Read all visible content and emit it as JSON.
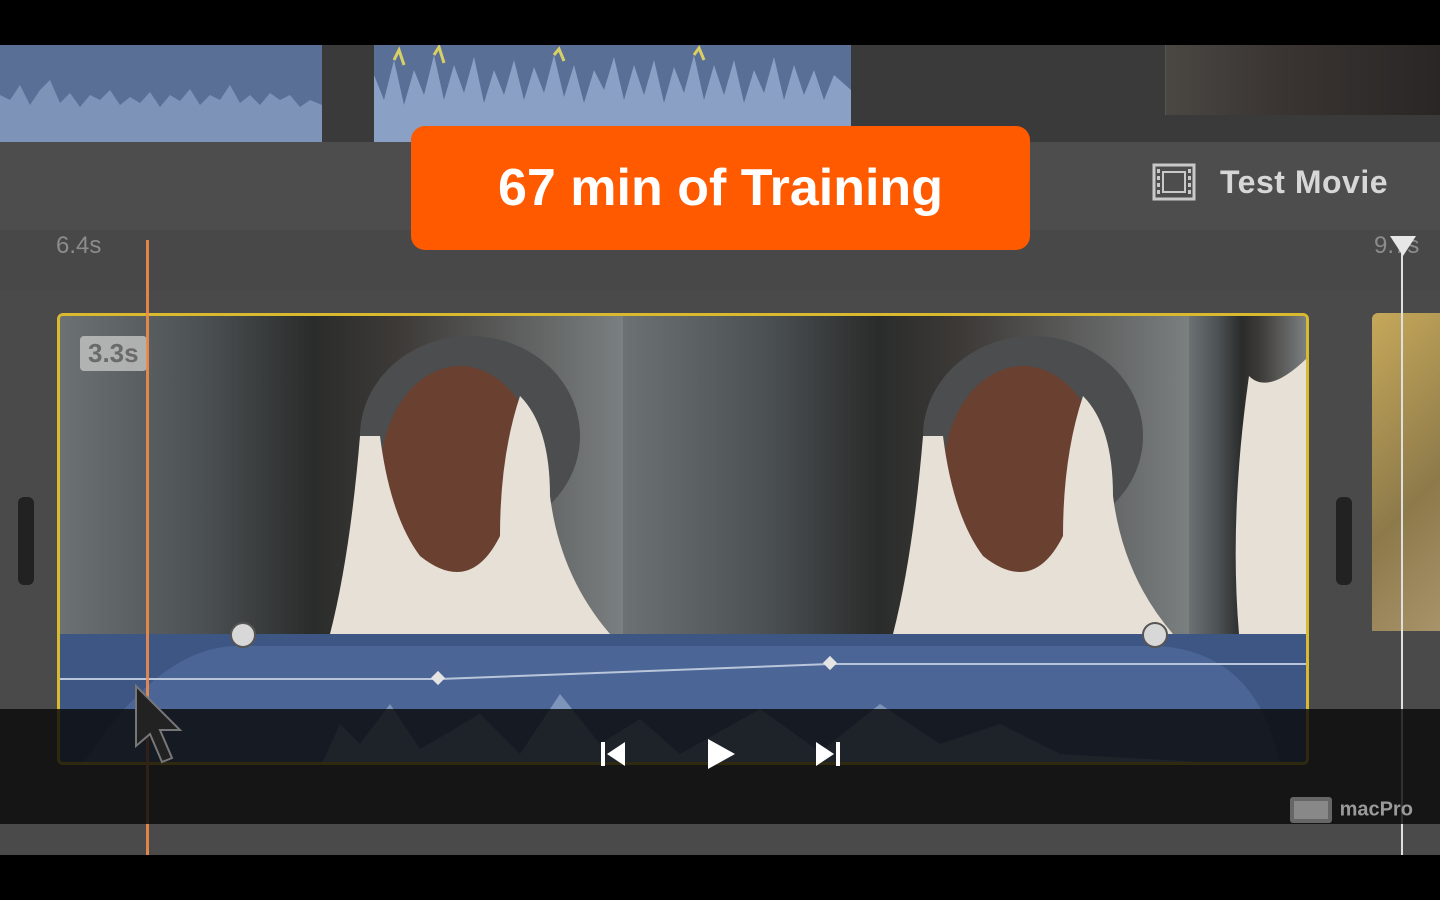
{
  "promo": {
    "text": "67 min of Training"
  },
  "ruler": {
    "start_time": "6.4s",
    "end_time": "9.7s"
  },
  "project": {
    "title": "Test Movie",
    "icon": "film-icon"
  },
  "clip": {
    "duration": "3.3s"
  },
  "controls": {
    "prev_icon": "skip-back-icon",
    "play_icon": "play-icon",
    "next_icon": "skip-forward-icon"
  },
  "watermark": {
    "text": "macPro"
  },
  "colors": {
    "promo": "#ff5a00",
    "clip_border": "#d9b930",
    "playhead": "#f08c4d",
    "audio": "#3d5684"
  }
}
